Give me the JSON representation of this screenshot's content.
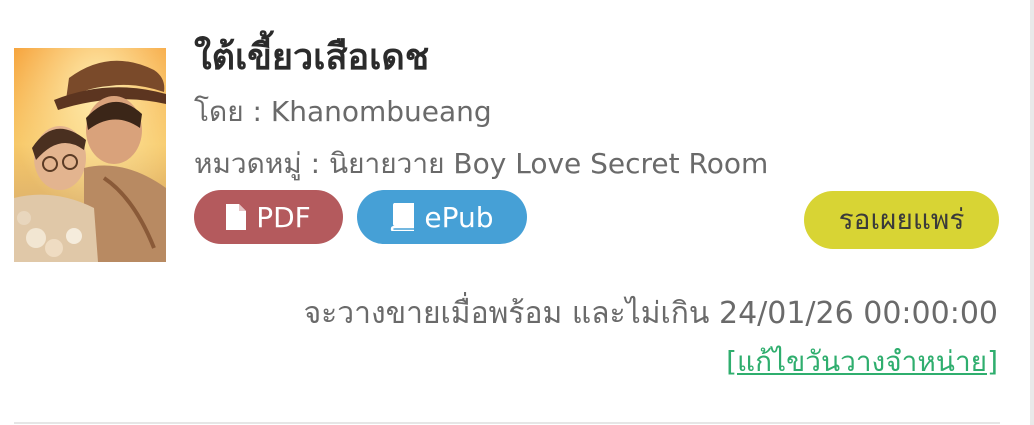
{
  "book": {
    "title": "ใต้เขี้ยวเสือเดช",
    "author_line": "โดย : Khanombueang",
    "category_line": "หมวดหมู่ : นิยายวาย Boy Love Secret Room"
  },
  "formats": {
    "pdf_label": "PDF",
    "epub_label": "ePub",
    "pdf_icon": "document-icon",
    "epub_icon": "book-icon"
  },
  "status": {
    "label": "รอเผยแพร่",
    "color": "#d8d434"
  },
  "release": {
    "text": "จะวางขายเมื่อพร้อม และไม่เกิน 24/01/26 00:00:00",
    "edit_link": "[แก้ไขวันวางจำหน่าย]"
  },
  "colors": {
    "pdf": "#b45a5d",
    "epub": "#46a0d6",
    "link": "#2fae6e"
  }
}
